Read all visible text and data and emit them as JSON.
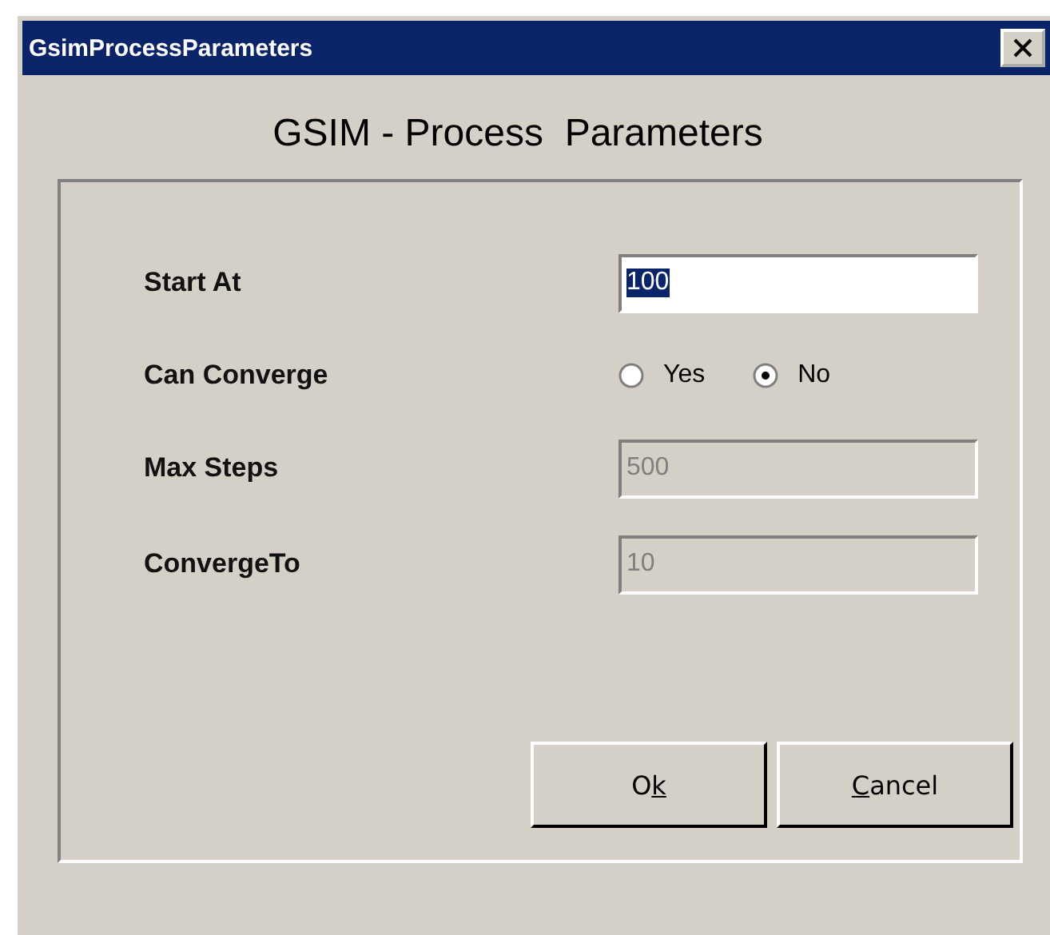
{
  "window": {
    "title": "GsimProcessParameters"
  },
  "heading": "GSIM - Process  Parameters",
  "rows": [
    {
      "kind": "text",
      "label": "Start At",
      "value": "100",
      "disabled": false,
      "value_selected": true
    },
    {
      "kind": "radio",
      "label": "Can Converge",
      "options": [
        {
          "label": "Yes",
          "selected": false
        },
        {
          "label": "No",
          "selected": true
        }
      ]
    },
    {
      "kind": "text",
      "label": "Max Steps",
      "value": "500",
      "disabled": true,
      "value_selected": false
    },
    {
      "kind": "text",
      "label": "ConvergeTo",
      "value": "10",
      "disabled": true,
      "value_selected": false
    }
  ],
  "buttons": [
    {
      "label_parts": [
        {
          "text": "O",
          "underlined": false
        },
        {
          "text": "k",
          "underlined": true
        }
      ]
    },
    {
      "label_parts": [
        {
          "text": "C",
          "underlined": true
        },
        {
          "text": "ancel",
          "underlined": false
        }
      ]
    }
  ]
}
